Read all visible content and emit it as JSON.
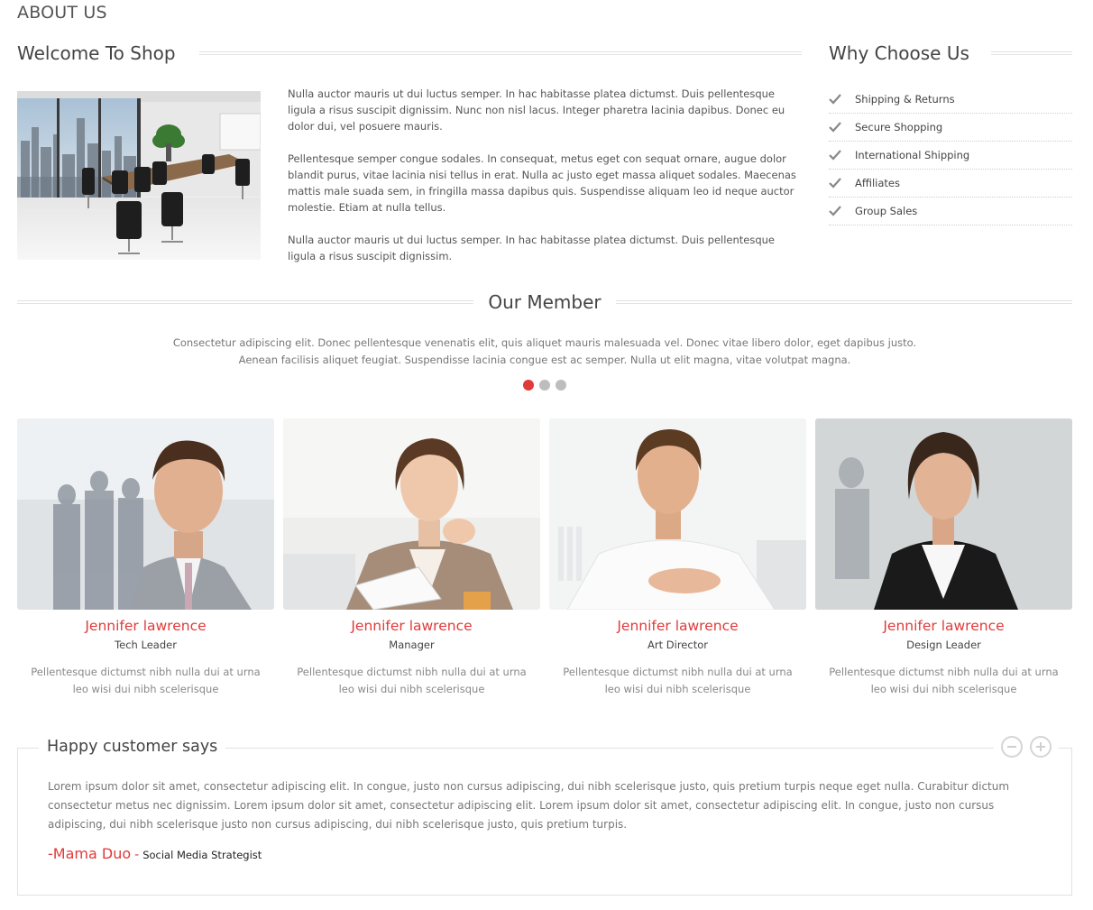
{
  "page": {
    "title": "ABOUT US"
  },
  "welcome": {
    "heading": "Welcome To Shop",
    "image_alt": "Modern office conference room",
    "paragraphs": [
      "Nulla auctor mauris ut dui luctus semper. In hac habitasse platea dictumst. Duis pellentesque ligula a risus suscipit dignissim. Nunc non nisl lacus. Integer pharetra lacinia dapibus. Donec eu dolor dui, vel posuere mauris.",
      "Pellentesque semper congue sodales. In consequat, metus eget con sequat ornare, augue dolor blandit purus, vitae lacinia nisi tellus in erat. Nulla ac justo eget massa aliquet sodales. Maecenas mattis male suada sem, in fringilla massa dapibus quis. Suspendisse aliquam leo id neque auctor molestie. Etiam at nulla tellus.",
      "Nulla auctor mauris ut dui luctus semper. In hac habitasse platea dictumst. Duis pellentesque ligula a risus suscipit dignissim."
    ]
  },
  "why": {
    "heading": "Why Choose Us",
    "items": [
      {
        "label": "Shipping & Returns",
        "icon": "check-icon"
      },
      {
        "label": "Secure Shopping",
        "icon": "check-icon"
      },
      {
        "label": "International Shipping",
        "icon": "check-icon"
      },
      {
        "label": "Affiliates",
        "icon": "check-icon"
      },
      {
        "label": "Group Sales",
        "icon": "check-icon"
      }
    ]
  },
  "members": {
    "heading": "Our Member",
    "description_lines": [
      "Consectetur adipiscing elit. Donec pellentesque venenatis elit, quis aliquet mauris malesuada vel. Donec vitae libero dolor, eget dapibus justo.",
      "Aenean facilisis aliquet feugiat. Suspendisse lacinia congue est ac semper. Nulla ut elit magna, vitae volutpat magna."
    ],
    "carousel": {
      "total": 3,
      "active": 1
    },
    "people": [
      {
        "name": "Jennifer lawrence",
        "role": "Tech Leader",
        "bio": "Pellentesque dictumst nibh nulla dui at urna leo wisi dui nibh scelerisque"
      },
      {
        "name": "Jennifer lawrence",
        "role": "Manager",
        "bio": "Pellentesque dictumst nibh nulla dui at urna leo wisi dui nibh scelerisque"
      },
      {
        "name": "Jennifer lawrence",
        "role": "Art Director",
        "bio": "Pellentesque dictumst nibh nulla dui at urna leo wisi dui nibh scelerisque"
      },
      {
        "name": "Jennifer lawrence",
        "role": "Design Leader",
        "bio": "Pellentesque dictumst nibh nulla dui at urna leo wisi dui nibh scelerisque"
      }
    ]
  },
  "testimonial": {
    "heading": "Happy customer says",
    "prev_icon": "minus-circle-icon",
    "next_icon": "plus-circle-icon",
    "text": "Lorem ipsum dolor sit amet, consectetur adipiscing elit. In congue, justo non cursus adipiscing, dui nibh scelerisque justo, quis pretium turpis neque eget nulla. Curabitur dictum consectetur metus nec dignissim. Lorem ipsum dolor sit amet, consectetur adipiscing elit. Lorem ipsum dolor sit amet, consectetur adipiscing elit. In congue, justo non cursus adipiscing, dui nibh scelerisque justo non cursus adipiscing, dui nibh scelerisque justo, quis pretium turpis.",
    "author_dash": "- ",
    "author_name": "Mama Duo",
    "author_sep": "-",
    "author_role": "Social Media Strategist"
  },
  "colors": {
    "accent": "#e03a3a",
    "text": "#555555",
    "muted": "#888888",
    "rule": "#e2e2e2",
    "dot_inactive": "#bdbdbd"
  }
}
